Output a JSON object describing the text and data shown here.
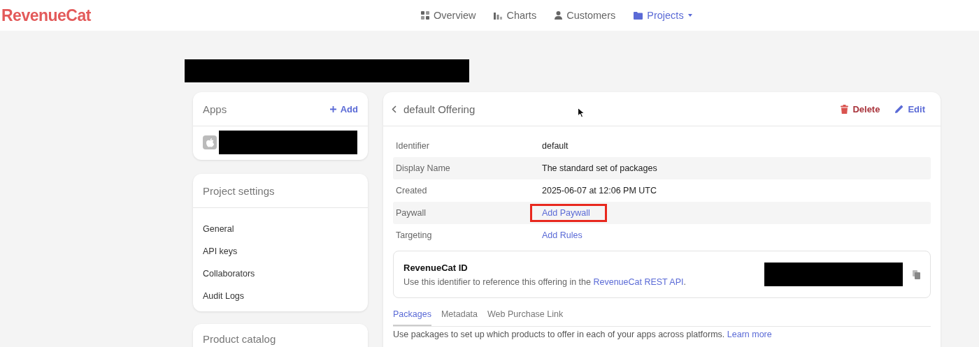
{
  "brand": {
    "name": "RevenueCat"
  },
  "nav": [
    {
      "label": "Overview",
      "selected": false,
      "dropdown": false
    },
    {
      "label": "Charts",
      "selected": false,
      "dropdown": false
    },
    {
      "label": "Customers",
      "selected": false,
      "dropdown": false
    },
    {
      "label": "Projects",
      "selected": true,
      "dropdown": true
    }
  ],
  "apps_card": {
    "title": "Apps",
    "add_label": "Add"
  },
  "project_settings": {
    "title": "Project settings",
    "items": [
      "General",
      "API keys",
      "Collaborators",
      "Audit Logs"
    ]
  },
  "product_catalog": {
    "title": "Product catalog"
  },
  "offering": {
    "title": "default Offering",
    "delete_label": "Delete",
    "edit_label": "Edit",
    "fields": [
      {
        "label": "Identifier",
        "value": "default",
        "kind": "text",
        "shaded": false,
        "highlighted": false
      },
      {
        "label": "Display Name",
        "value": "The standard set of packages",
        "kind": "text",
        "shaded": true,
        "highlighted": false
      },
      {
        "label": "Created",
        "value": "2025-06-07 at 12:06 PM UTC",
        "kind": "text",
        "shaded": false,
        "highlighted": false
      },
      {
        "label": "Paywall",
        "value": "Add Paywall",
        "kind": "link",
        "shaded": true,
        "highlighted": true
      },
      {
        "label": "Targeting",
        "value": "Add Rules",
        "kind": "link",
        "shaded": false,
        "highlighted": false
      }
    ],
    "id_box": {
      "title": "RevenueCat ID",
      "description": "Use this identifier to reference this offering in the ",
      "link": "RevenueCat REST API",
      "after_link": "."
    },
    "tabs": [
      {
        "label": "Packages",
        "selected": true
      },
      {
        "label": "Metadata",
        "selected": false
      },
      {
        "label": "Web Purchase Link",
        "selected": false
      }
    ],
    "packages_text": "Use packages to set up which products to offer in each of your apps across platforms.",
    "learn_more": "Learn more"
  }
}
